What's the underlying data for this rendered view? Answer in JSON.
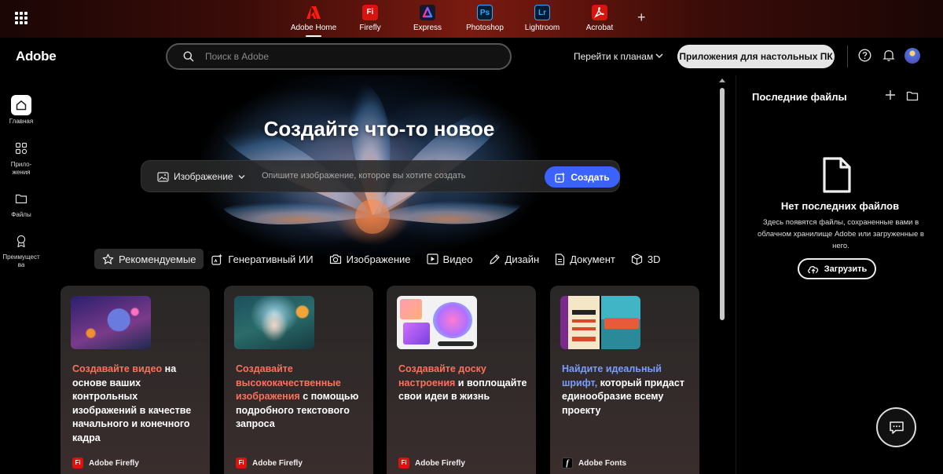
{
  "topbar": {
    "apps": [
      {
        "label": "Adobe Home",
        "badge": "",
        "color": "#d8140e",
        "active": true
      },
      {
        "label": "Firefly",
        "badge": "Fi",
        "color": "#d8140e"
      },
      {
        "label": "Express",
        "badge": "",
        "color": "#1a1a2e"
      },
      {
        "label": "Photoshop",
        "badge": "Ps",
        "color": "#001e36"
      },
      {
        "label": "Lightroom",
        "badge": "Lr",
        "color": "#001a33"
      },
      {
        "label": "Acrobat",
        "badge": "",
        "color": "#d8140e"
      }
    ],
    "add_tab": "+"
  },
  "header": {
    "brand": "Adobe",
    "search_placeholder": "Поиск в Adobe",
    "plans_label": "Перейти к планам",
    "desktop_apps_label": "Приложения для настольных ПК"
  },
  "sidebar": {
    "items": [
      {
        "label": "Главная",
        "icon": "home-icon",
        "active": true
      },
      {
        "label": "Прило-\nжения",
        "icon": "apps-icon"
      },
      {
        "label": "Файлы",
        "icon": "folder-icon"
      },
      {
        "label": "Преимущест\nва",
        "icon": "award-icon"
      }
    ]
  },
  "hero": {
    "title": "Создайте что-то новое",
    "type_selector": "Изображение",
    "prompt_placeholder": "Опишите изображение, которое вы хотите создать",
    "create_label": "Создать"
  },
  "categories": [
    {
      "label": "Рекомендуемые",
      "icon": "star-icon",
      "active": true
    },
    {
      "label": "Генеративный ИИ",
      "icon": "sparkle-icon"
    },
    {
      "label": "Изображение",
      "icon": "camera-icon"
    },
    {
      "label": "Видео",
      "icon": "video-icon"
    },
    {
      "label": "Дизайн",
      "icon": "pen-icon"
    },
    {
      "label": "Документ",
      "icon": "document-icon"
    },
    {
      "label": "3D",
      "icon": "cube-icon"
    }
  ],
  "cards": [
    {
      "highlight": "Создавайте видео",
      "rest": " на основе ваших контрольных изображений в качестве начального и конечного кадра",
      "app": "Adobe Firefly",
      "app_badge": "Fi",
      "accent": "#ff6f5c"
    },
    {
      "highlight": "Создавайте высококачественные изображения",
      "rest": " с помощью подробного текстового запроса",
      "app": "Adobe Firefly",
      "app_badge": "Fi",
      "accent": "#ff6f5c"
    },
    {
      "highlight": "Создавайте доску настроения",
      "rest": " и воплощайте свои идеи в жизнь",
      "app": "Adobe Firefly",
      "app_badge": "Fi",
      "accent": "#ff6f5c"
    },
    {
      "highlight": "Найдите идеальный шрифт,",
      "rest": " который придаст единообразие всему проекту",
      "app": "Adobe Fonts",
      "app_badge": "f",
      "accent": "#7b9cff"
    }
  ],
  "recent_files": {
    "title": "Последние файлы",
    "empty_title": "Нет последних файлов",
    "empty_desc": "Здесь появятся файлы, сохраненные вами в облачном хранилище Adobe или загруженные в него.",
    "upload_label": "Загрузить"
  }
}
